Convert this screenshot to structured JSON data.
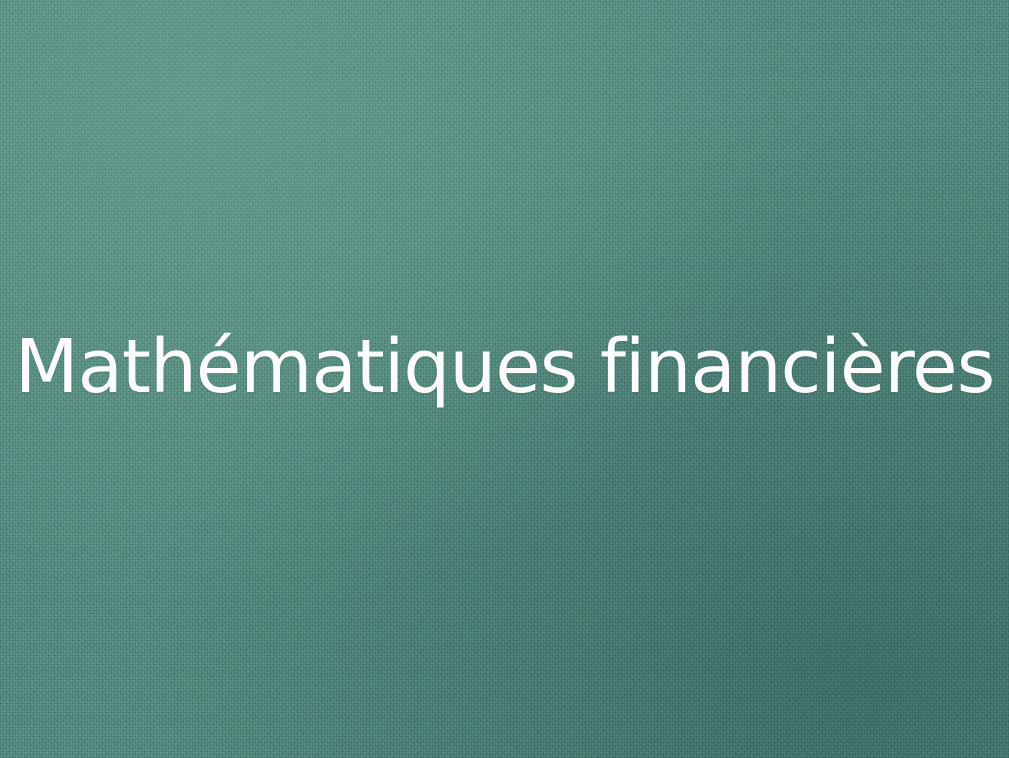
{
  "title": "Mathématiques financières",
  "colors": {
    "background": "#4d897d",
    "title_text": "#fbfbfb"
  }
}
